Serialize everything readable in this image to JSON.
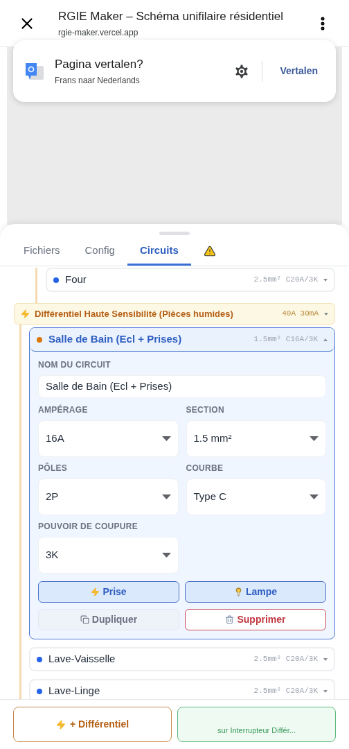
{
  "browser": {
    "title": "RGIE Maker – Schéma unifilaire résidentiel",
    "url": "rgie-maker.vercel.app"
  },
  "translate": {
    "title": "Pagina vertalen?",
    "subtitle": "Frans naar Nederlands",
    "action": "Vertalen"
  },
  "tabs": [
    {
      "kind": "text",
      "label": "Fichiers",
      "selected": false
    },
    {
      "kind": "text",
      "label": "Config",
      "selected": false
    },
    {
      "kind": "text",
      "label": "Circuits",
      "selected": true
    },
    {
      "kind": "warning",
      "selected": false
    }
  ],
  "tree": [
    {
      "kind": "circuit",
      "name": "Four",
      "color": "#2563eb",
      "specs": "2.5mm² C20A/3K",
      "expanded": false
    },
    {
      "kind": "differential",
      "name": "Différentiel Haute Sensibilité (Pièces humides)",
      "rating": "40A 30mA",
      "expanded": true,
      "children": [
        {
          "kind": "circuit",
          "name": "Salle de Bain (Ecl + Prises)",
          "color": "#d97706",
          "specs": "1.5mm² C16A/3K",
          "expanded": true,
          "fields": [
            {
              "kind": "text",
              "label": "NOM DU CIRCUIT",
              "value": "Salle de Bain (Ecl + Prises)"
            },
            {
              "kind": "select",
              "label": "AMPÉRAGE",
              "value": "16A"
            },
            {
              "kind": "select",
              "label": "SECTION",
              "value": "1.5 mm²"
            },
            {
              "kind": "select",
              "label": "PÔLES",
              "value": "2P"
            },
            {
              "kind": "select",
              "label": "COURBE",
              "value": "Type C"
            },
            {
              "kind": "select",
              "label": "POUVOIR DE COUPURE",
              "value": "3K"
            }
          ],
          "actions": [
            {
              "kind": "plug",
              "label": "Prise",
              "selected": true
            },
            {
              "kind": "lamp",
              "label": "Lampe",
              "selected": true
            },
            {
              "kind": "duplicate",
              "label": "Dupliquer"
            },
            {
              "kind": "delete",
              "label": "Supprimer"
            }
          ]
        },
        {
          "kind": "circuit",
          "name": "Lave-Vaisselle",
          "color": "#2563eb",
          "specs": "2.5mm² C20A/3K",
          "expanded": false
        },
        {
          "kind": "circuit",
          "name": "Lave-Linge",
          "color": "#2563eb",
          "specs": "2.5mm² C20A/3K",
          "expanded": false
        }
      ]
    }
  ],
  "footer": [
    {
      "kind": "differential",
      "label": "+ Différentiel"
    },
    {
      "kind": "switch",
      "label": "sur Interrupteur Différ..."
    }
  ]
}
